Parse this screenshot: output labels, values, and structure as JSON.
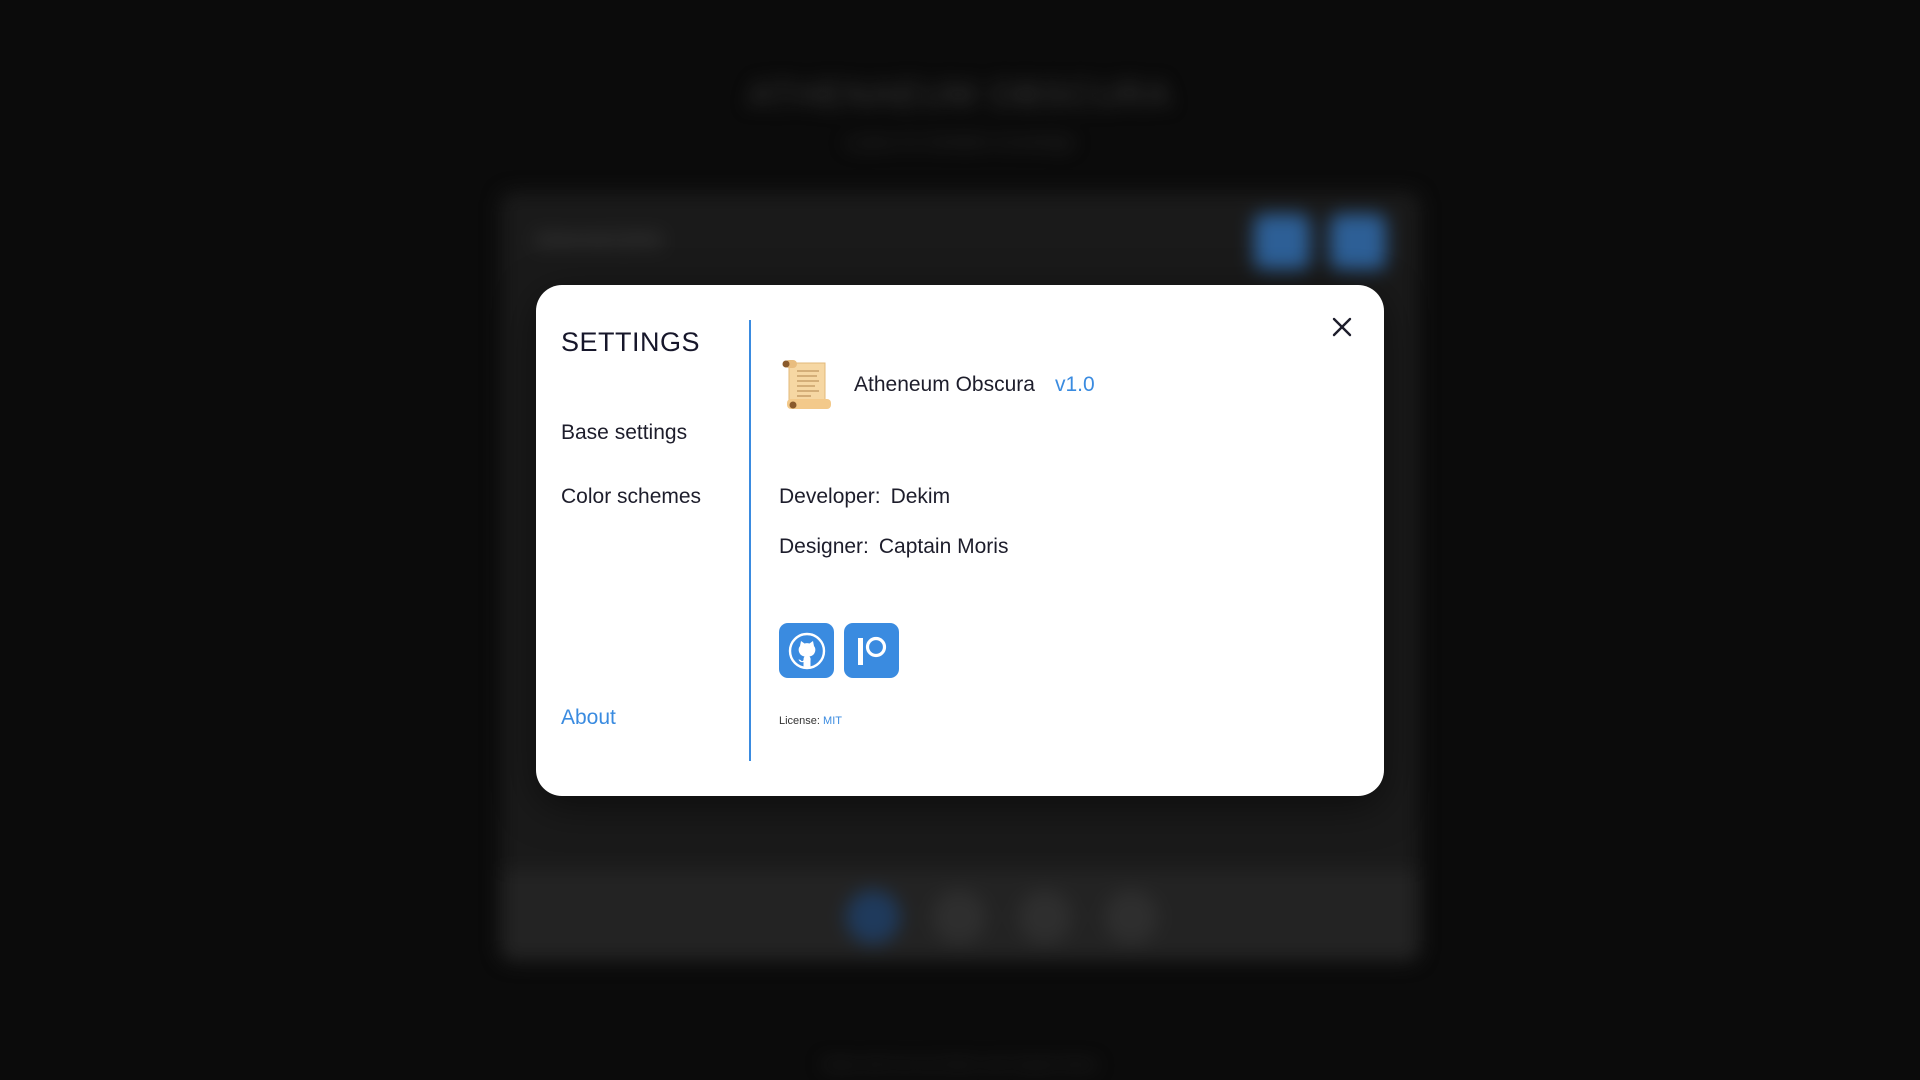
{
  "background": {
    "title": "ATHENAEUM OBSCURA",
    "subtitle": "a place for forbidden knowledge",
    "card_label": "ENHANCERS",
    "footer": "Made with love by Dekim and Captain Moris"
  },
  "settings": {
    "title": "SETTINGS",
    "menu": [
      {
        "label": "Base settings",
        "active": false
      },
      {
        "label": "Color schemes",
        "active": false
      },
      {
        "label": "About",
        "active": true
      }
    ]
  },
  "about": {
    "app_name": "Atheneum Obscura",
    "version": "v1.0",
    "developer_label": "Developer:",
    "developer": "Dekim",
    "designer_label": "Designer:",
    "designer": "Captain Moris",
    "license_label": "License:",
    "license_value": "MIT",
    "social": [
      {
        "name": "GitHub",
        "icon": "github-icon"
      },
      {
        "name": "Patreon",
        "icon": "patreon-icon"
      }
    ]
  },
  "colors": {
    "accent": "#3a8be0",
    "modal_bg": "#ffffff",
    "page_bg": "#0b0b0b",
    "text": "#1d1d2b"
  },
  "icons": {
    "close": "close-icon",
    "app": "scroll-icon"
  }
}
